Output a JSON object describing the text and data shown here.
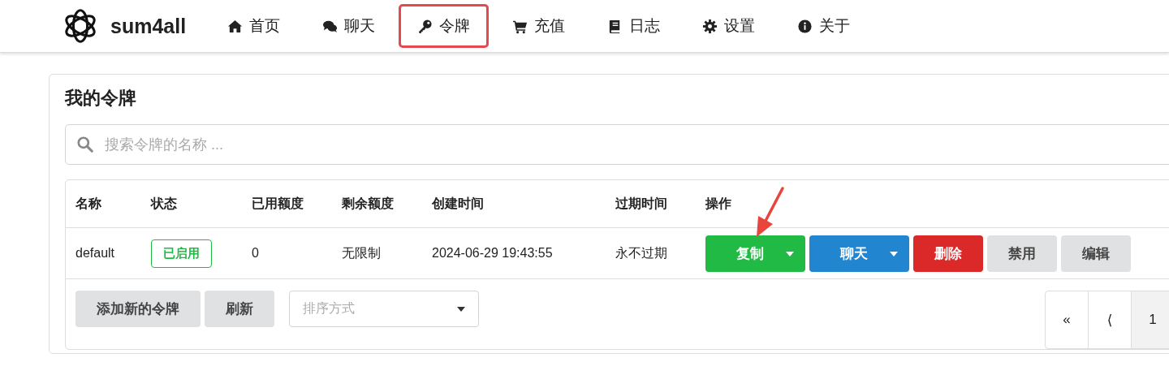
{
  "header": {
    "brand": "sum4all",
    "nav": [
      {
        "label": "首页",
        "kind": "home",
        "selected": false
      },
      {
        "label": "聊天",
        "kind": "chat",
        "selected": false
      },
      {
        "label": "令牌",
        "kind": "key",
        "selected": true
      },
      {
        "label": "充值",
        "kind": "cart",
        "selected": false
      },
      {
        "label": "日志",
        "kind": "book",
        "selected": false
      },
      {
        "label": "设置",
        "kind": "gear",
        "selected": false
      },
      {
        "label": "关于",
        "kind": "info",
        "selected": false
      }
    ]
  },
  "card": {
    "title": "我的令牌",
    "search": {
      "placeholder": "搜索令牌的名称 ..."
    },
    "table": {
      "columns": [
        "名称",
        "状态",
        "已用额度",
        "剩余额度",
        "创建时间",
        "过期时间",
        "操作"
      ],
      "rows": [
        {
          "name": "default",
          "status": {
            "label": "已启用",
            "kind": "enabled"
          },
          "used": "0",
          "remaining": "无限制",
          "created": "2024-06-29 19:43:55",
          "expires": "永不过期",
          "actions": [
            {
              "label": "复制",
              "kind": "success",
              "dropdown": true
            },
            {
              "label": "聊天",
              "kind": "primary",
              "dropdown": true
            },
            {
              "label": "删除",
              "kind": "danger",
              "dropdown": false
            },
            {
              "label": "禁用",
              "kind": "default",
              "dropdown": false
            },
            {
              "label": "编辑",
              "kind": "default",
              "dropdown": false
            }
          ]
        }
      ]
    },
    "footer_buttons": [
      "添加新的令牌",
      "刷新"
    ],
    "sort": {
      "placeholder": "排序方式"
    },
    "pagination": [
      {
        "label": "«",
        "selected": false
      },
      {
        "label": "⟨",
        "selected": false
      },
      {
        "label": "1",
        "selected": true
      }
    ]
  }
}
